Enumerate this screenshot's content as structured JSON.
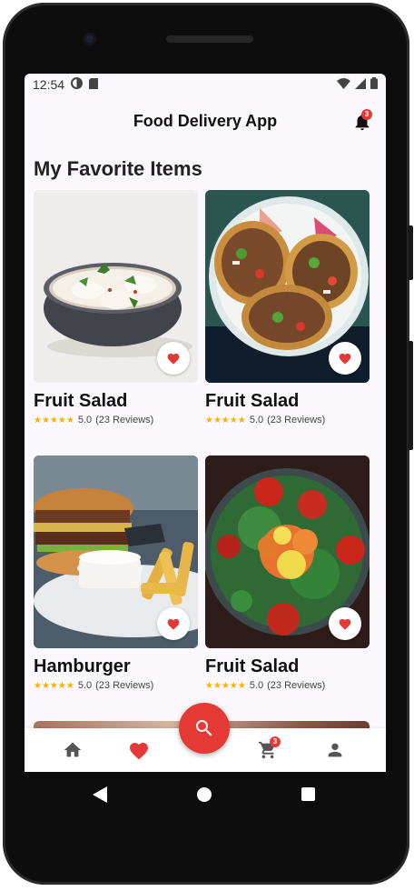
{
  "statusbar": {
    "time": "12:54"
  },
  "header": {
    "title": "Food Delivery App",
    "notification_count": "3"
  },
  "section": {
    "title": "My Favorite Items"
  },
  "items": [
    {
      "name": "Fruit Salad",
      "rating": "5.0",
      "reviews": "(23 Reviews)",
      "image": "dumplings-bowl"
    },
    {
      "name": "Fruit Salad",
      "rating": "5.0",
      "reviews": "(23 Reviews)",
      "image": "tacos-plate"
    },
    {
      "name": "Hamburger",
      "rating": "5.0",
      "reviews": "(23 Reviews)",
      "image": "burger-fries"
    },
    {
      "name": "Fruit Salad",
      "rating": "5.0",
      "reviews": "(23 Reviews)",
      "image": "salad-bowl"
    }
  ],
  "bottom_nav": {
    "items": [
      "home-icon",
      "heart-icon",
      "search-icon",
      "cart-icon",
      "profile-icon"
    ],
    "cart_count": "3",
    "active": "favorites"
  },
  "colors": {
    "accent": "#e53935",
    "star": "#f5b400",
    "background": "#faf8fc"
  }
}
